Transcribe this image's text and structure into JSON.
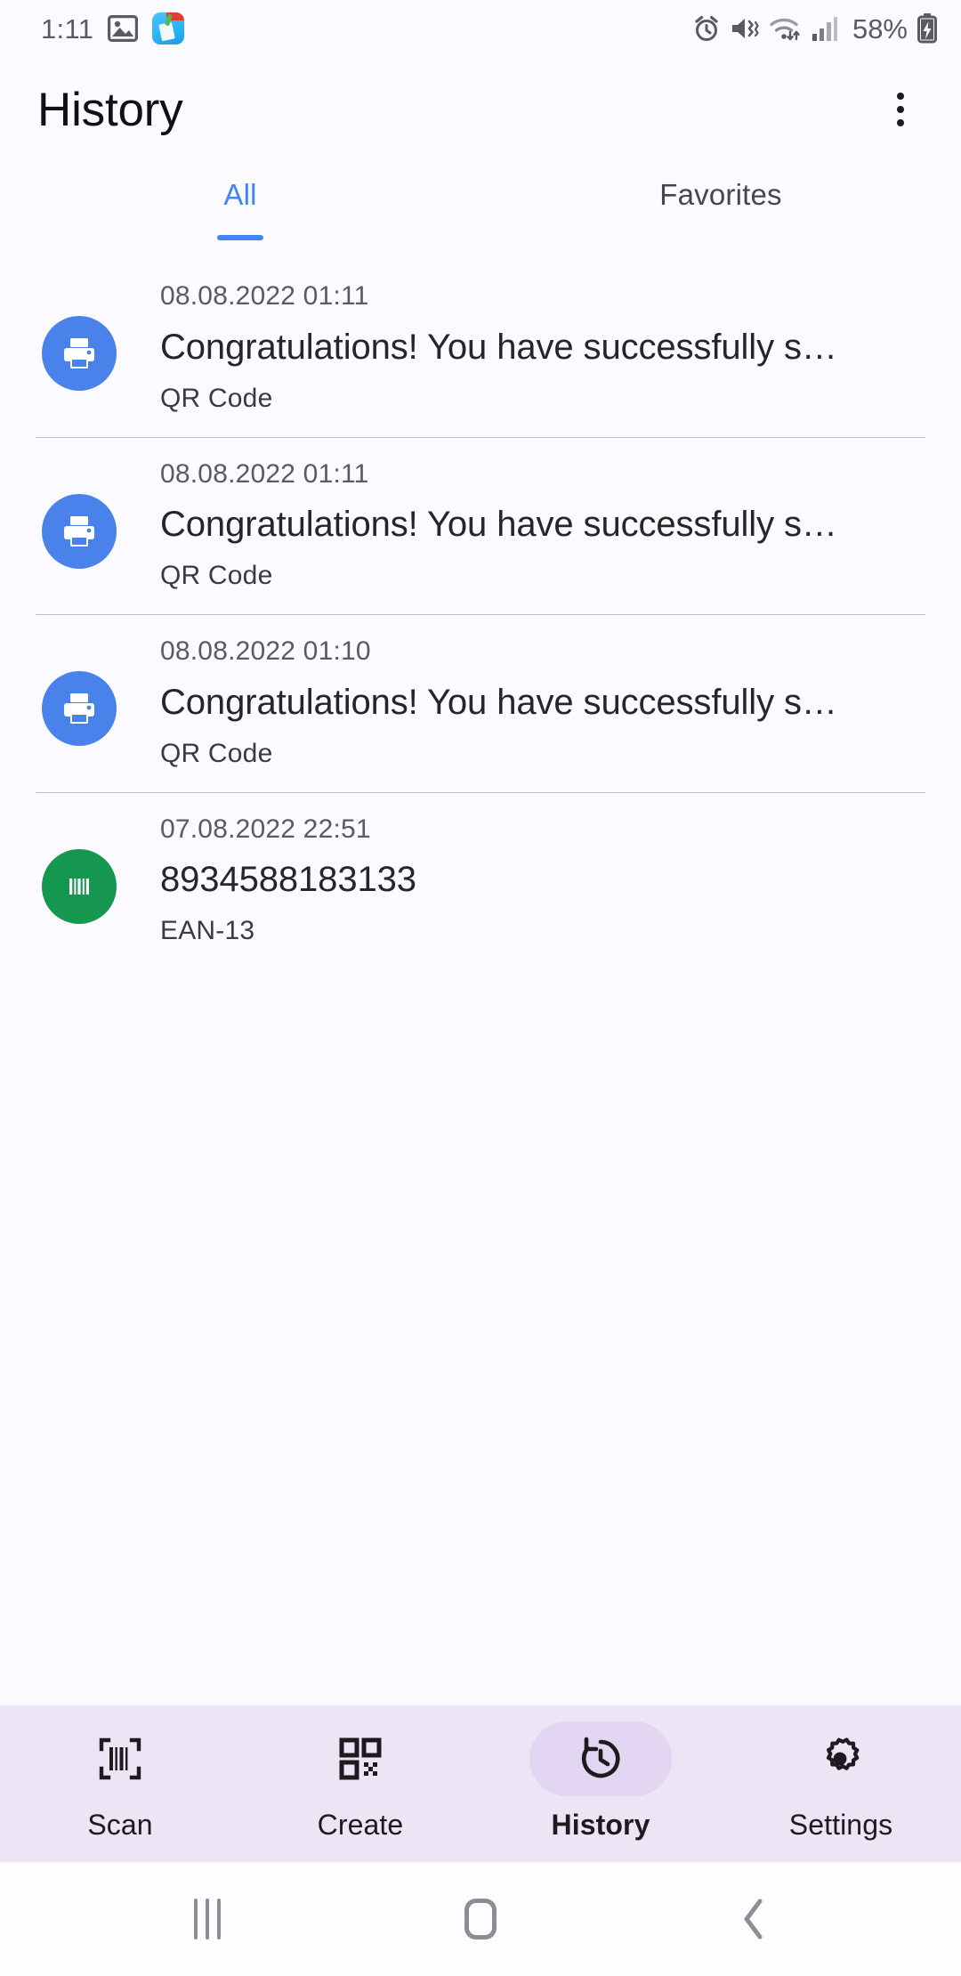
{
  "status_bar": {
    "time": "1:11",
    "battery_percent": "58%",
    "left_icons": [
      "image-icon",
      "cleaner-app-icon"
    ],
    "right_icons": [
      "alarm-icon",
      "mute-vibrate-icon",
      "wifi-icon",
      "cellular-signal-icon",
      "battery-charging-icon"
    ]
  },
  "app_bar": {
    "title": "History",
    "overflow_icon": "more-vertical-icon"
  },
  "tabs": [
    {
      "label": "All",
      "active": true
    },
    {
      "label": "Favorites",
      "active": false
    }
  ],
  "colors": {
    "accent_blue": "#4285f4",
    "qr_avatar_blue": "#4a82ec",
    "barcode_avatar_green": "#16974f",
    "bottom_nav_bg": "#ece5f5",
    "nav_pill": "#e2d6f3"
  },
  "history_items": [
    {
      "icon": "printer-icon",
      "avatar_color": "blue",
      "date": "08.08.2022 01:11",
      "title": "Congratulations! You have successfully s…",
      "format": "QR Code"
    },
    {
      "icon": "printer-icon",
      "avatar_color": "blue",
      "date": "08.08.2022 01:11",
      "title": "Congratulations! You have successfully s…",
      "format": "QR Code"
    },
    {
      "icon": "printer-icon",
      "avatar_color": "blue",
      "date": "08.08.2022 01:10",
      "title": "Congratulations! You have successfully s…",
      "format": "QR Code"
    },
    {
      "icon": "barcode-icon",
      "avatar_color": "green",
      "date": "07.08.2022 22:51",
      "title": "8934588183133",
      "format": "EAN-13"
    }
  ],
  "bottom_nav": [
    {
      "label": "Scan",
      "icon": "barcode-scan-icon",
      "active": false
    },
    {
      "label": "Create",
      "icon": "qr-code-icon",
      "active": false
    },
    {
      "label": "History",
      "icon": "history-clock-icon",
      "active": true
    },
    {
      "label": "Settings",
      "icon": "gear-icon",
      "active": false
    }
  ],
  "system_nav": {
    "recents": "recents-icon",
    "home": "home-icon",
    "back": "back-icon"
  }
}
